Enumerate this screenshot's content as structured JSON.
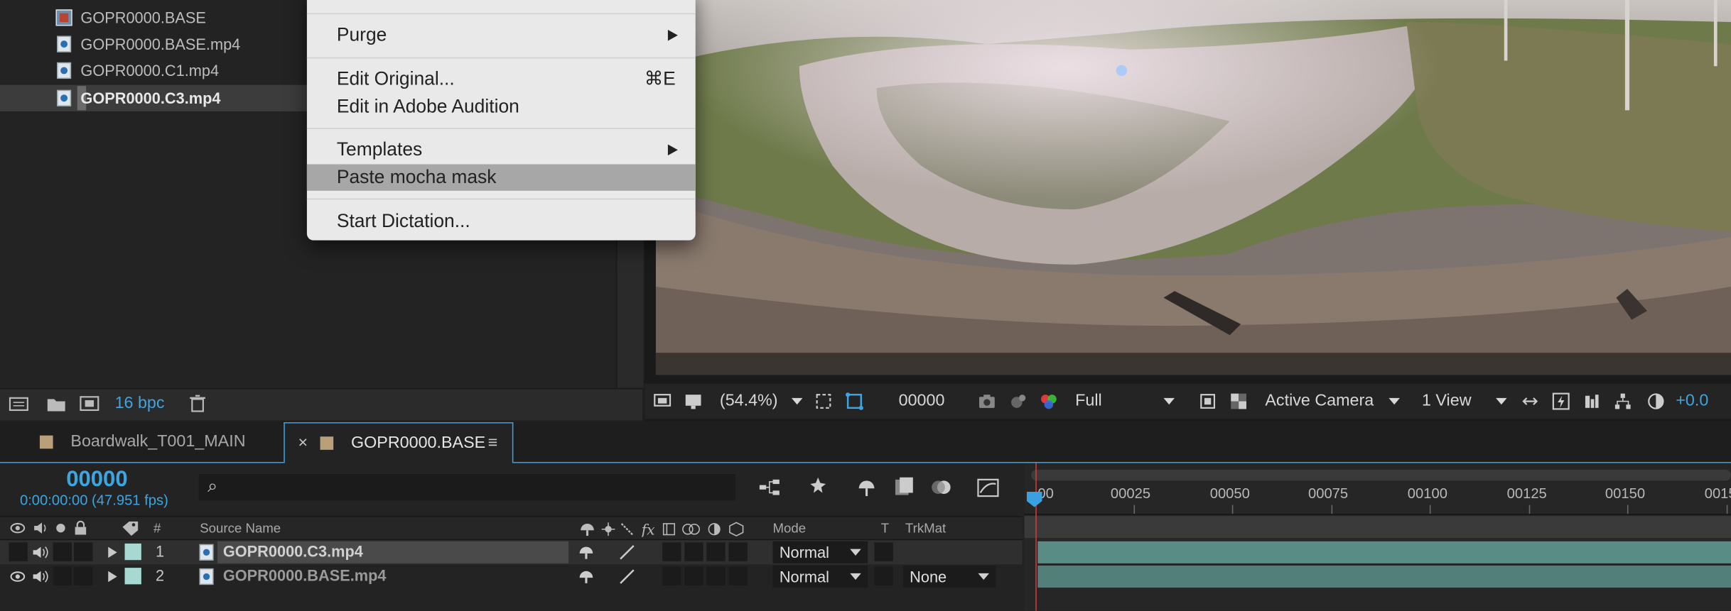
{
  "project": {
    "items": [
      {
        "name": "GOPR0000.BASE",
        "type": "composition"
      },
      {
        "name": "GOPR0000.BASE.mp4",
        "type": "footage"
      },
      {
        "name": "GOPR0000.C1.mp4",
        "type": "footage"
      },
      {
        "name": "GOPR0000.C3.mp4",
        "type": "footage",
        "selected": true
      }
    ],
    "footer": {
      "bpc_label": "16 bpc"
    }
  },
  "context_menu": {
    "items": [
      {
        "label": "Purge",
        "submenu": true
      },
      {
        "label": "Edit Original...",
        "shortcut": "⌘E"
      },
      {
        "label": "Edit in Adobe Audition"
      },
      {
        "label": "Templates",
        "submenu": true
      },
      {
        "label": "Paste mocha mask",
        "highlighted": true
      },
      {
        "label": "Start Dictation..."
      }
    ]
  },
  "viewer": {
    "toolbar": {
      "zoom": "(54.4%)",
      "timecode": "00000",
      "resolution": "Full",
      "camera": "Active Camera",
      "views": "1 View",
      "exposure": "+0.0"
    }
  },
  "timeline": {
    "tabs": [
      {
        "label": "Boardwalk_T001_MAIN",
        "active": false
      },
      {
        "label": "GOPR0000.BASE",
        "active": true,
        "close": "×",
        "menu": "≡"
      }
    ],
    "current_time": "00000",
    "time_fps": "0:00:00:00 (47.951 fps)",
    "search_icon": "⌕",
    "columns": {
      "num": "#",
      "source_name": "Source Name",
      "mode": "Mode",
      "t": "T",
      "trkmat": "TrkMat"
    },
    "layers": [
      {
        "num": "1",
        "name": "GOPR0000.C3.mp4",
        "mode": "Normal",
        "trkmat": ""
      },
      {
        "num": "2",
        "name": "GOPR0000.BASE.mp4",
        "mode": "Normal",
        "trkmat": "None"
      }
    ],
    "ruler": {
      "labels": [
        "00",
        "00025",
        "00050",
        "00075",
        "00100",
        "00125",
        "00150",
        "0015"
      ]
    },
    "colors": {
      "accent": "#3da5e0",
      "label": "#a8d8d2",
      "clip": "#5a8c86",
      "playhead": "#d23a3a"
    }
  }
}
